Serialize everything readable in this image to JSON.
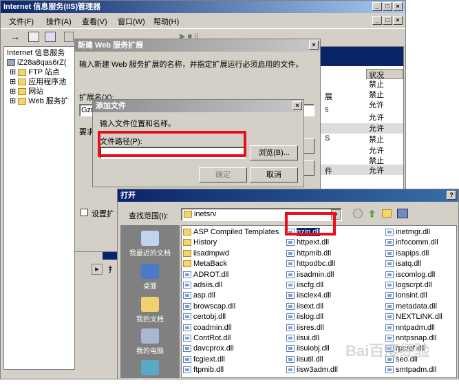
{
  "iis": {
    "title": "Internet 信息服务(IIS)管理器",
    "menu": [
      "文件(F)",
      "操作(A)",
      "查看(V)",
      "窗口(W)",
      "帮助(H)"
    ],
    "tree": [
      "Internet 信息服务",
      "iZ28a8qas6rZ(",
      "FTP 站点",
      "应用程序池",
      "网站",
      "Web 服务扩"
    ],
    "status_header": "状况",
    "status": [
      "禁止",
      "禁止",
      "允许",
      "允许",
      "允许",
      "禁止",
      "允许",
      "禁止",
      "允许"
    ],
    "mid_labels": [
      "展",
      "s",
      "S",
      "件"
    ],
    "bottom_label": "扌"
  },
  "new_ext": {
    "title": "新建 Web 服务扩展",
    "desc": "输入新建 Web 服务扩展的名称，并指定扩展运行必须启用的文件。",
    "name_label": "扩展名(X):",
    "name_value": "Gzi",
    "req_label": "要求",
    "set_label": "设置扩"
  },
  "add_file": {
    "title": "添加文件",
    "desc": "输入文件位置和名称。",
    "path_label": "文件路径(P):",
    "path_value": "",
    "browse": "浏览(B)...",
    "ok": "确定",
    "cancel": "取消"
  },
  "open": {
    "title": "打开",
    "lookin_label": "查找范围(I):",
    "lookin_value": "inetsrv",
    "places": [
      "我最近的文档",
      "桌面",
      "我的文档",
      "我的电脑",
      "网上邻居"
    ],
    "col1": [
      {
        "name": "ASP Compiled Templates",
        "type": "folder"
      },
      {
        "name": "History",
        "type": "folder"
      },
      {
        "name": "iisadmpwd",
        "type": "folder"
      },
      {
        "name": "MetaBack",
        "type": "folder"
      },
      {
        "name": "ADROT.dll",
        "type": "dll"
      },
      {
        "name": "adsiis.dll",
        "type": "dll"
      },
      {
        "name": "asp.dll",
        "type": "dll"
      },
      {
        "name": "browscap.dll",
        "type": "dll"
      },
      {
        "name": "certobj.dll",
        "type": "dll"
      },
      {
        "name": "coadmin.dll",
        "type": "dll"
      },
      {
        "name": "ContRot.dll",
        "type": "dll"
      },
      {
        "name": "davcprox.dll",
        "type": "dll"
      },
      {
        "name": "fcgiext.dll",
        "type": "dll"
      },
      {
        "name": "ftpmib.dll",
        "type": "dll"
      }
    ],
    "col2": [
      {
        "name": "gzip.dll",
        "type": "dll"
      },
      {
        "name": "httpext.dll",
        "type": "dll"
      },
      {
        "name": "httpmib.dll",
        "type": "dll"
      },
      {
        "name": "httpodbc.dll",
        "type": "dll"
      },
      {
        "name": "iisadmin.dll",
        "type": "dll"
      },
      {
        "name": "iiscfg.dll",
        "type": "dll"
      },
      {
        "name": "iisclex4.dll",
        "type": "dll"
      },
      {
        "name": "iisext.dll",
        "type": "dll"
      },
      {
        "name": "iislog.dll",
        "type": "dll"
      },
      {
        "name": "iisres.dll",
        "type": "dll"
      },
      {
        "name": "iisui.dll",
        "type": "dll"
      },
      {
        "name": "iisuiobj.dll",
        "type": "dll"
      },
      {
        "name": "iisutil.dll",
        "type": "dll"
      },
      {
        "name": "iisw3adm.dll",
        "type": "dll"
      }
    ],
    "col3": [
      {
        "name": "inetmgr.dll",
        "type": "dll"
      },
      {
        "name": "infocomm.dll",
        "type": "dll"
      },
      {
        "name": "isapips.dll",
        "type": "dll"
      },
      {
        "name": "isatq.dll",
        "type": "dll"
      },
      {
        "name": "iscomlog.dll",
        "type": "dll"
      },
      {
        "name": "logscrpt.dll",
        "type": "dll"
      },
      {
        "name": "lonsint.dll",
        "type": "dll"
      },
      {
        "name": "metadata.dll",
        "type": "dll"
      },
      {
        "name": "NEXTLINK.dll",
        "type": "dll"
      },
      {
        "name": "nntpadm.dll",
        "type": "dll"
      },
      {
        "name": "nntpsnap.dll",
        "type": "dll"
      },
      {
        "name": "rpcref.dll",
        "type": "dll"
      },
      {
        "name": "seo.dll",
        "type": "dll"
      },
      {
        "name": "smtpadm.dll",
        "type": "dll"
      }
    ]
  },
  "watermark": "Bai百度经验"
}
